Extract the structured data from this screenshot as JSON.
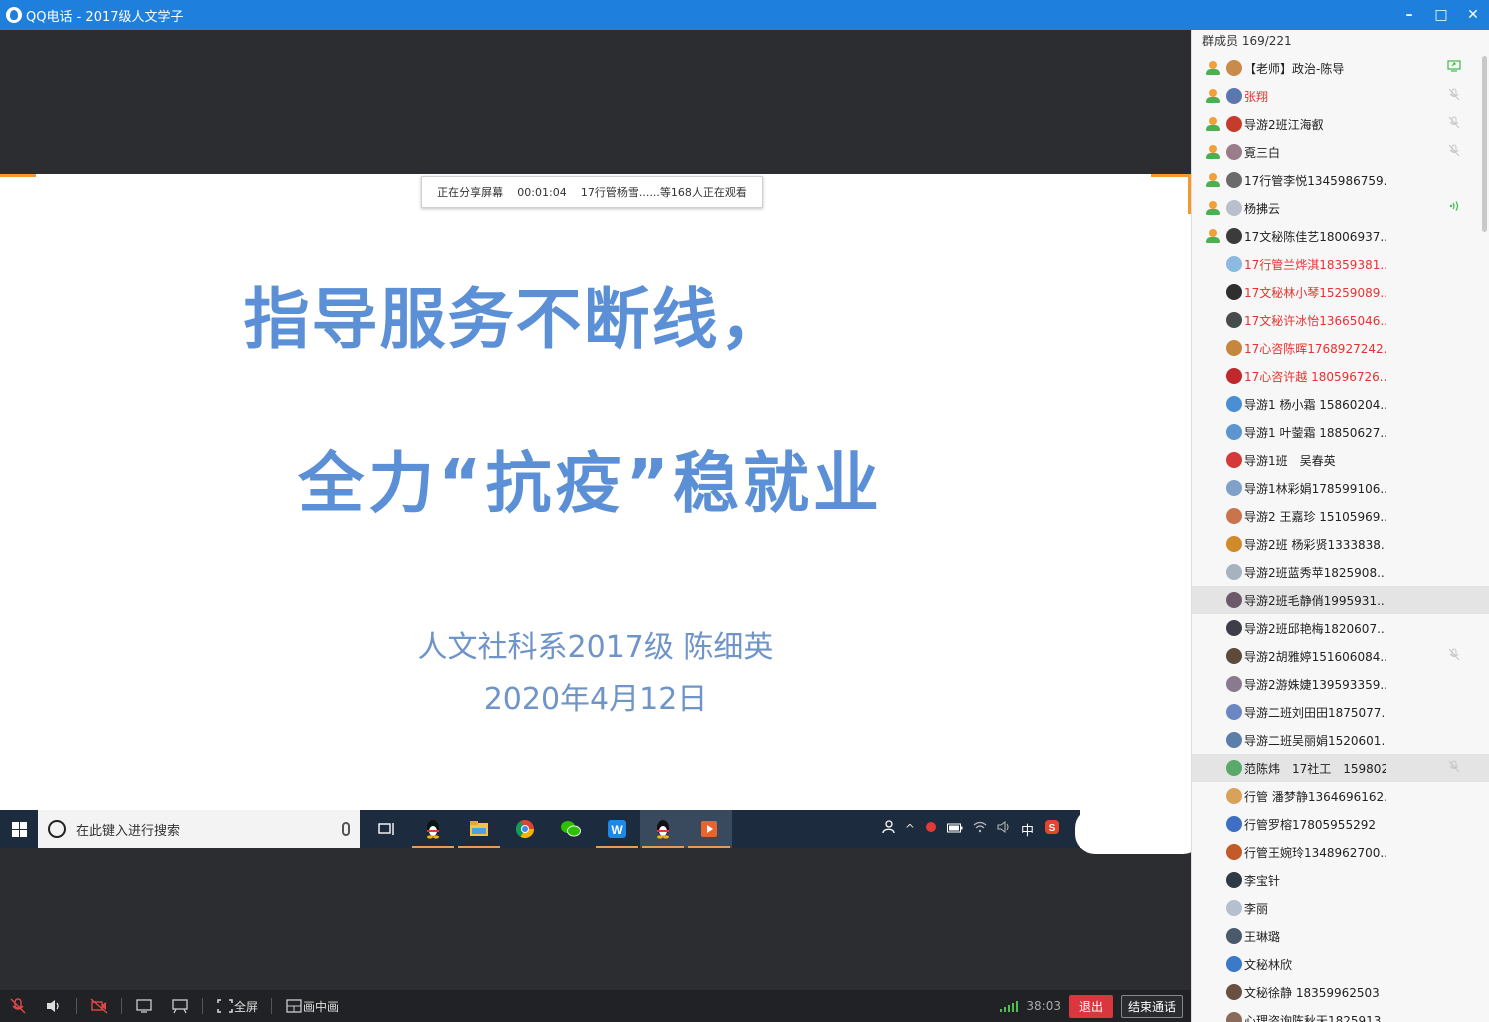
{
  "window": {
    "title": "QQ电话 - 2017级人文学子",
    "controls": [
      "–",
      "□",
      "✕"
    ]
  },
  "share_banner": {
    "status": "正在分享屏幕",
    "elapsed": "00:01:04",
    "viewers": "17行管杨雪......等168人正在观看"
  },
  "slide": {
    "title_line1": "指导服务不断线，",
    "title_line2": "全力“抗疫”稳就业",
    "author": "人文社科系2017级 陈细英",
    "date": "2020年4月12日",
    "title_color": "#5b8fd6"
  },
  "taskbar": {
    "search_placeholder": "在此键入进行搜索",
    "apps": [
      "task-view-icon",
      "qq-icon",
      "file-explorer-icon",
      "chrome-icon",
      "wechat-icon",
      "wps-icon",
      "qq-icon",
      "media-player-icon"
    ],
    "ime": "中"
  },
  "controls": {
    "fullscreen": "全屏",
    "pip": "画中画",
    "timer": "38:03",
    "exit": "退出",
    "end_call": "结束通话"
  },
  "members": {
    "count_label": "群成员 169/221",
    "list": [
      {
        "name": "【老师】政治-陈导",
        "red": false,
        "online": true,
        "status": "screen",
        "avatar": "#c98b4b"
      },
      {
        "name": "张翔",
        "red": true,
        "online": true,
        "status": "muted",
        "avatar": "#5a78b0"
      },
      {
        "name": "导游2班江海叡",
        "red": false,
        "online": true,
        "status": "muted",
        "avatar": "#c63c2c"
      },
      {
        "name": "覔三白",
        "red": false,
        "online": true,
        "status": "muted",
        "avatar": "#9a7c8a"
      },
      {
        "name": "17行管李悦1345986759...",
        "red": false,
        "online": true,
        "status": "",
        "avatar": "#6b6b6b"
      },
      {
        "name": "杨拂云",
        "red": false,
        "online": true,
        "status": "speaking",
        "avatar": "#b9c0cc"
      },
      {
        "name": "17文秘陈佳艺18006937...",
        "red": false,
        "online": true,
        "status": "",
        "avatar": "#3b3b3b"
      },
      {
        "name": "17行管兰烨淇18359381...",
        "red": true,
        "online": false,
        "status": "",
        "avatar": "#8fb8e0"
      },
      {
        "name": "17文秘林小琴15259089...",
        "red": true,
        "online": false,
        "status": "",
        "avatar": "#2f2f2f"
      },
      {
        "name": "17文秘许冰怡13665046...",
        "red": true,
        "online": false,
        "status": "",
        "avatar": "#4a4a4a"
      },
      {
        "name": "17心咨陈晖1768927242...",
        "red": true,
        "online": false,
        "status": "",
        "avatar": "#c7863e"
      },
      {
        "name": "17心咨许越 180596726...",
        "red": true,
        "online": false,
        "status": "",
        "avatar": "#c0282d"
      },
      {
        "name": "导游1 杨小霜 15860204...",
        "red": false,
        "online": false,
        "status": "",
        "avatar": "#4a8fd3"
      },
      {
        "name": "导游1 叶蓥霜 18850627...",
        "red": false,
        "online": false,
        "status": "",
        "avatar": "#5d95cf"
      },
      {
        "name": "导游1班　吴春英",
        "red": false,
        "online": false,
        "status": "",
        "avatar": "#d43a3a"
      },
      {
        "name": "导游1林彩娟178599106...",
        "red": false,
        "online": false,
        "status": "",
        "avatar": "#7fa0c9"
      },
      {
        "name": "导游2 王嘉珍 15105969...",
        "red": false,
        "online": false,
        "status": "",
        "avatar": "#c9744a"
      },
      {
        "name": "导游2班 杨彩贤1333838...",
        "red": false,
        "online": false,
        "status": "",
        "avatar": "#d08a2c"
      },
      {
        "name": "导游2班蓝秀苹1825908...",
        "red": false,
        "online": false,
        "status": "",
        "avatar": "#a7b2bf"
      },
      {
        "name": "导游2班毛静俏1995931...",
        "red": false,
        "online": false,
        "status": "",
        "avatar": "#6a5a6a",
        "highlight": true
      },
      {
        "name": "导游2班邱艳梅1820607...",
        "red": false,
        "online": false,
        "status": "",
        "avatar": "#3e3e48"
      },
      {
        "name": "导游2胡雅婷151606084...",
        "red": false,
        "online": false,
        "status": "muted",
        "avatar": "#5d4a3a"
      },
      {
        "name": "导游2游姝婕139593359...",
        "red": false,
        "online": false,
        "status": "",
        "avatar": "#8a7a8e"
      },
      {
        "name": "导游二班刘田田1875077...",
        "red": false,
        "online": false,
        "status": "",
        "avatar": "#6c86c4"
      },
      {
        "name": "导游二班吴丽娟1520601...",
        "red": false,
        "online": false,
        "status": "",
        "avatar": "#5b7fa8"
      },
      {
        "name": "范陈炜　17社工　159802...",
        "red": false,
        "online": false,
        "status": "muted",
        "avatar": "#5aa86a",
        "highlight": true
      },
      {
        "name": "行管 潘梦静1364696162...",
        "red": false,
        "online": false,
        "status": "",
        "avatar": "#d9a25a"
      },
      {
        "name": "行管罗榕17805955292",
        "red": false,
        "online": false,
        "status": "",
        "avatar": "#3d6fc2"
      },
      {
        "name": "行管王婉玲1348962700...",
        "red": false,
        "online": false,
        "status": "",
        "avatar": "#c35a2a"
      },
      {
        "name": "李宝针",
        "red": false,
        "online": false,
        "status": "",
        "avatar": "#2f3a44"
      },
      {
        "name": "李丽",
        "red": false,
        "online": false,
        "status": "",
        "avatar": "#b6bfd0"
      },
      {
        "name": "王琳璐",
        "red": false,
        "online": false,
        "status": "",
        "avatar": "#4a5a6a"
      },
      {
        "name": "文秘林欣",
        "red": false,
        "online": false,
        "status": "",
        "avatar": "#3a7ac8"
      },
      {
        "name": "文秘徐静 18359962503",
        "red": false,
        "online": false,
        "status": "",
        "avatar": "#6a5040"
      },
      {
        "name": "心理咨询陈秋天1825913...",
        "red": false,
        "online": false,
        "status": "",
        "avatar": "#8a6a5a"
      }
    ]
  }
}
